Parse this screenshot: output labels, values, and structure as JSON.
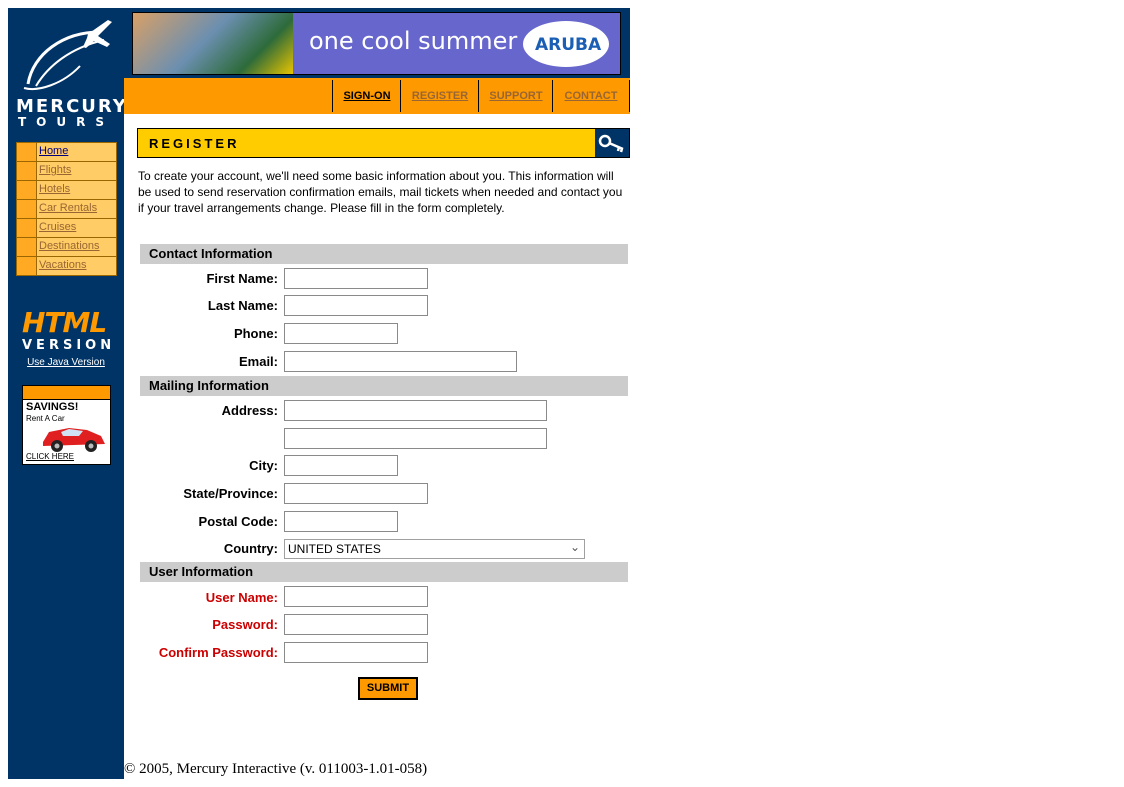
{
  "logo": {
    "word1": "MERCURY",
    "word2": "TOURS"
  },
  "left_nav": {
    "items": [
      {
        "label": "Home"
      },
      {
        "label": "Flights"
      },
      {
        "label": "Hotels"
      },
      {
        "label": "Car Rentals"
      },
      {
        "label": "Cruises"
      },
      {
        "label": "Destinations"
      },
      {
        "label": "Vacations"
      }
    ]
  },
  "html_badge": {
    "big": "HTML",
    "small": "VERSION",
    "java_link": "Use Java Version"
  },
  "ad": {
    "line1": "SAVINGS!",
    "line2": "Rent A Car",
    "line3": "CLICK HERE"
  },
  "banner": {
    "slogan": "one cool summer",
    "brand": "ARUBA"
  },
  "top_nav": {
    "tabs": [
      {
        "label": "SIGN-ON"
      },
      {
        "label": "REGISTER"
      },
      {
        "label": "SUPPORT"
      },
      {
        "label": "CONTACT"
      }
    ]
  },
  "page": {
    "title": "REGISTER",
    "intro": "To create your account, we'll need some basic information about you. This information will be used to send reservation confirmation emails, mail tickets when needed and contact you if your travel arrangements change. Please fill in the form completely."
  },
  "form": {
    "contact_header": "Contact Information",
    "first_name_label": "First Name:",
    "last_name_label": "Last Name:",
    "phone_label": "Phone:",
    "email_label": "Email:",
    "mailing_header": "Mailing Information",
    "address_label": "Address:",
    "city_label": "City:",
    "state_label": "State/Province:",
    "postal_label": "Postal Code:",
    "country_label": "Country:",
    "country_value": "UNITED STATES",
    "user_header": "User Information",
    "username_label": "User Name:",
    "password_label": "Password:",
    "confirm_label": "Confirm Password:",
    "submit_label": "SUBMIT"
  },
  "footer": {
    "text": "© 2005, Mercury Interactive (v. 011003-1.01-058)"
  },
  "colors": {
    "sidebar": "#003366",
    "accent": "#ff9900",
    "header_yellow": "#ffcc00",
    "section_gray": "#cccccc",
    "required_red": "#cc0000"
  }
}
